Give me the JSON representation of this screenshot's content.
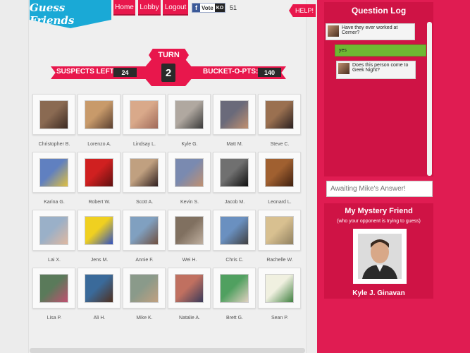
{
  "header": {
    "logo": "Guess Friends",
    "nav": [
      "Home",
      "Lobby",
      "Logout"
    ],
    "vote_label": "Vote",
    "vote_ko": "KO",
    "vote_count": "51",
    "help": "HELP!"
  },
  "status": {
    "turn_label": "TURN",
    "turn_number": "2",
    "suspects_label": "SUSPECTS LEFT:",
    "suspects_value": "24",
    "bucket_label": "BUCKET-O-PTS:",
    "bucket_value": "140"
  },
  "suspects": [
    {
      "name": "Christopher B.",
      "a": "#8a6a52",
      "b": "#3d2a22"
    },
    {
      "name": "Lorenzo A.",
      "a": "#c89a6a",
      "b": "#5a4030"
    },
    {
      "name": "Lindsay L.",
      "a": "#d9a98a",
      "b": "#a06a5a"
    },
    {
      "name": "Kyle G.",
      "a": "#b0a8a0",
      "b": "#3a3a3a"
    },
    {
      "name": "Matt M.",
      "a": "#6a6a7a",
      "b": "#c09070"
    },
    {
      "name": "Steve C.",
      "a": "#9a7050",
      "b": "#2a2020"
    },
    {
      "name": "Karina G.",
      "a": "#6080c0",
      "b": "#e0c040"
    },
    {
      "name": "Robert W.",
      "a": "#d02020",
      "b": "#601010"
    },
    {
      "name": "Scott A.",
      "a": "#c0a080",
      "b": "#302020"
    },
    {
      "name": "Kevin S.",
      "a": "#7a8ab0",
      "b": "#c09070"
    },
    {
      "name": "Jacob M.",
      "a": "#707070",
      "b": "#101010"
    },
    {
      "name": "Leonard L.",
      "a": "#a06030",
      "b": "#402010"
    },
    {
      "name": "Lai X.",
      "a": "#9ab0c8",
      "b": "#e0b8a0"
    },
    {
      "name": "Jens M.",
      "a": "#f0d020",
      "b": "#3050c0"
    },
    {
      "name": "Annie F.",
      "a": "#80a0c0",
      "b": "#705040"
    },
    {
      "name": "Wei H.",
      "a": "#807060",
      "b": "#c0b0a0"
    },
    {
      "name": "Chris C.",
      "a": "#6a90c0",
      "b": "#404040"
    },
    {
      "name": "Rachelle W.",
      "a": "#d8c090",
      "b": "#908060"
    },
    {
      "name": "Lisa P.",
      "a": "#5a7a5a",
      "b": "#c05070"
    },
    {
      "name": "Ali H.",
      "a": "#3a6a9a",
      "b": "#503020"
    },
    {
      "name": "Mike K.",
      "a": "#8a9a8a",
      "b": "#c0a080"
    },
    {
      "name": "Natalie A.",
      "a": "#c07060",
      "b": "#3a3a5a"
    },
    {
      "name": "Brett G.",
      "a": "#50a060",
      "b": "#e0d0c0"
    },
    {
      "name": "Sean P.",
      "a": "#f0f0e0",
      "b": "#408040"
    }
  ],
  "question_log": {
    "title": "Question Log",
    "messages": [
      {
        "text": "Have they ever worked at Cerner?"
      },
      {
        "text": "yes"
      },
      {
        "text": "Does this person come to Geek Night?"
      }
    ]
  },
  "answer_input": {
    "placeholder": "Awaiting Mike's Answer!"
  },
  "mystery": {
    "title": "My Mystery Friend",
    "subtitle": "(who your opponent is trying to guess)",
    "name": "Kyle J. Ginavan"
  },
  "colors": {
    "accent": "#e8174c",
    "logo": "#1aa9d6",
    "answer_yes": "#6fb832"
  }
}
